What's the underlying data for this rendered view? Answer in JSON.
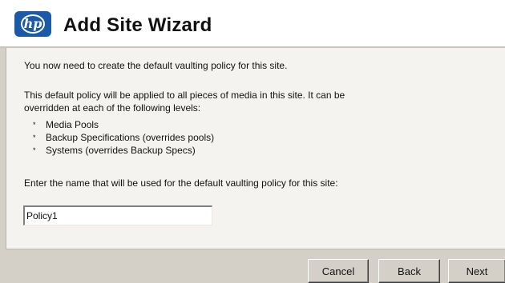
{
  "header": {
    "logo_text": "hp",
    "title": "Add Site Wizard"
  },
  "content": {
    "intro": "You now need to create the default vaulting policy for this site.",
    "policy_desc_line1": "This default policy will be applied to all pieces of media in this site. It can be",
    "policy_desc_line2": "overridden at each of the following levels:",
    "levels": [
      {
        "bullet": "*",
        "label": "Media Pools"
      },
      {
        "bullet": "*",
        "label": "Backup Specifications (overrides pools)"
      },
      {
        "bullet": "*",
        "label": "Systems (overrides Backup Specs)"
      }
    ],
    "name_prompt": "Enter the name that will be used for the default vaulting policy for this site:",
    "policy_name_value": "Policy1"
  },
  "buttons": {
    "cancel": "Cancel",
    "back": "Back",
    "next": "Next"
  }
}
